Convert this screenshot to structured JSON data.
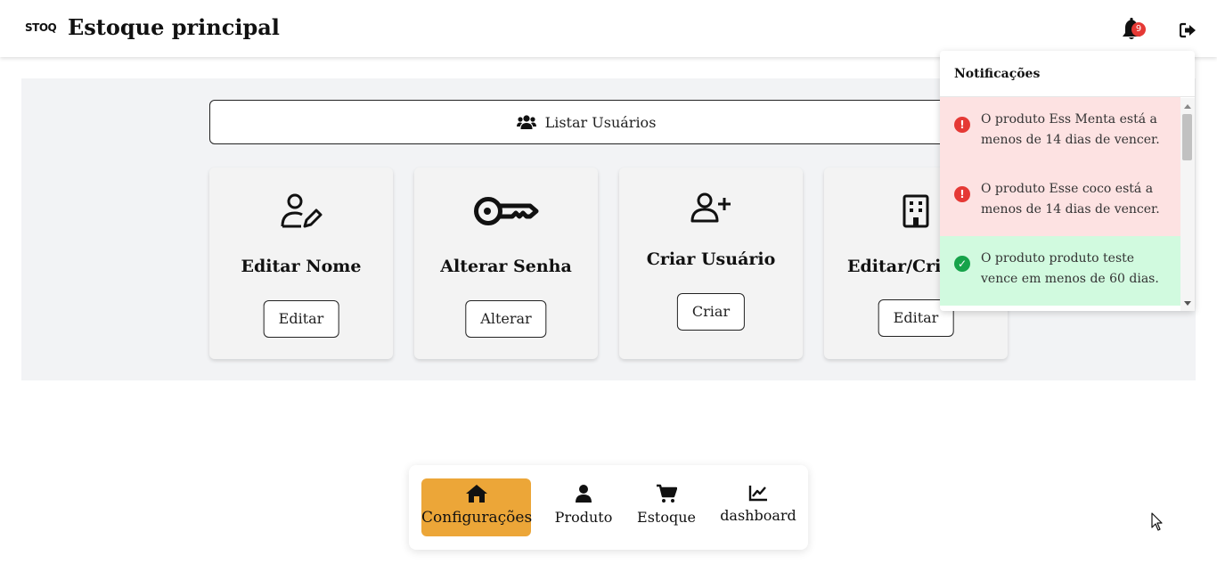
{
  "header": {
    "logo_text": "STOQ",
    "title": "Estoque principal",
    "notification_count": "9"
  },
  "main": {
    "list_users_label": "Listar Usuários",
    "cards": [
      {
        "title": "Editar Nome",
        "button": "Editar",
        "icon": "user-edit-icon"
      },
      {
        "title": "Alterar Senha",
        "button": "Alterar",
        "icon": "key-icon"
      },
      {
        "title": "Criar Usuário",
        "button": "Criar",
        "icon": "user-plus-icon"
      },
      {
        "title": "Editar/Cria",
        "button": "Editar",
        "icon": "building-icon"
      }
    ]
  },
  "notifications": {
    "title": "Notificações",
    "items": [
      {
        "type": "error",
        "text": "O produto Ess Menta está a menos de 14 dias de vencer."
      },
      {
        "type": "error",
        "text": "O produto Esse coco está a menos de 14 dias de vencer."
      },
      {
        "type": "success",
        "text": "O produto produto teste vence em menos de 60 dias."
      }
    ]
  },
  "bottom_nav": {
    "items": [
      {
        "label": "Configurações",
        "icon": "home-icon",
        "active": true
      },
      {
        "label": "Produto",
        "icon": "user-icon",
        "active": false
      },
      {
        "label": "Estoque",
        "icon": "cart-icon",
        "active": false
      },
      {
        "label": "dashboard",
        "icon": "chart-line-icon",
        "active": false
      }
    ]
  },
  "colors": {
    "accent": "#eca638",
    "panel_bg": "#f2f3f5",
    "error_bg": "#fde2e2",
    "success_bg": "#d1fadf",
    "badge": "#e53935"
  }
}
